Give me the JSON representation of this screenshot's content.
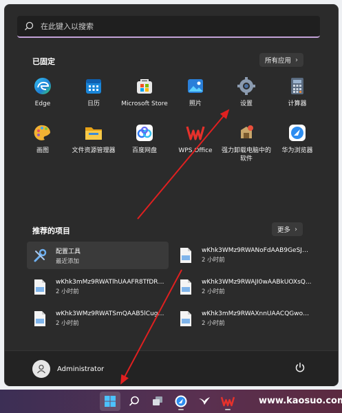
{
  "search": {
    "placeholder": "在此键入以搜索"
  },
  "pinned": {
    "title": "已固定",
    "all_apps_label": "所有应用",
    "apps": [
      {
        "label": "Edge",
        "icon": "edge-icon"
      },
      {
        "label": "日历",
        "icon": "calendar-icon"
      },
      {
        "label": "Microsoft Store",
        "icon": "store-icon"
      },
      {
        "label": "照片",
        "icon": "photos-icon"
      },
      {
        "label": "设置",
        "icon": "settings-gear-icon"
      },
      {
        "label": "计算器",
        "icon": "calculator-icon"
      },
      {
        "label": "画图",
        "icon": "paint-icon"
      },
      {
        "label": "文件资源管理器",
        "icon": "file-explorer-icon"
      },
      {
        "label": "百度网盘",
        "icon": "baidu-netdisk-icon"
      },
      {
        "label": "WPS Office",
        "icon": "wps-office-icon"
      },
      {
        "label": "强力卸载电脑中的软件",
        "icon": "uninstaller-icon"
      },
      {
        "label": "华为浏览器",
        "icon": "huawei-browser-icon"
      }
    ]
  },
  "recommended": {
    "title": "推荐的项目",
    "more_label": "更多",
    "items": [
      {
        "name": "配置工具",
        "time": "最近添加",
        "icon": "config-tool-icon"
      },
      {
        "name": "wKhk3WMz9RWANoFdAAB9GeSJH...",
        "time": "2 小时前",
        "icon": "image-file-icon"
      },
      {
        "name": "wKhk3mMz9RWATlhUAAFR8TfDRU...",
        "time": "2 小时前",
        "icon": "image-file-icon"
      },
      {
        "name": "wKhk3WMz9RWAJI0wAABkUOXsQ...",
        "time": "2 小时前",
        "icon": "image-file-icon"
      },
      {
        "name": "wKhk3WMz9RWATSmQAAB5lCug2...",
        "time": "2 小时前",
        "icon": "image-file-icon"
      },
      {
        "name": "wKhk3mMz9RWAXnnUAACQGwok...",
        "time": "2 小时前",
        "icon": "image-file-icon"
      }
    ]
  },
  "footer": {
    "user_name": "Administrator"
  },
  "watermark": "www.kaosuo.com"
}
